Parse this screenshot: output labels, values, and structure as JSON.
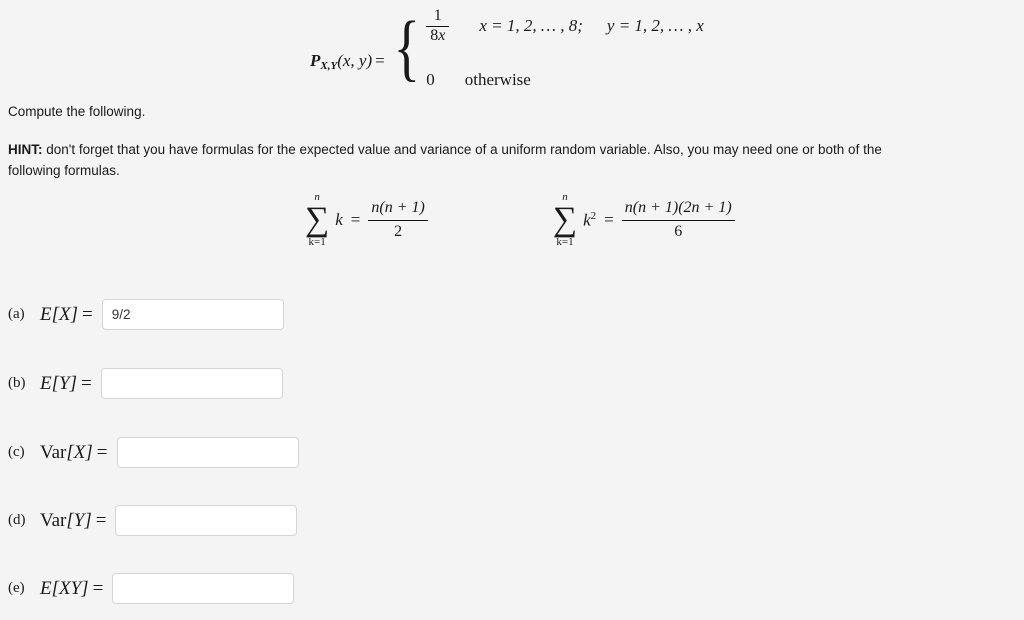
{
  "problem": {
    "pmf": {
      "lhs_p": "P",
      "lhs_sub": "X,Y",
      "lhs_args": "(x, y)",
      "equals": "=",
      "case1_numerator": "1",
      "case1_denominator_coeff": "8",
      "case1_denominator_var": "x",
      "case1_condition_x": "x = 1, 2, … , 8;",
      "case1_condition_y": "y = 1, 2, … , x",
      "case2_value": "0",
      "case2_condition": "otherwise"
    },
    "compute_instruction": "Compute the following.",
    "hint_bold": "HINT:",
    "hint_text": " don't forget that you have formulas for the expected value and variance of a uniform random variable. Also, you may need one or both of the following formulas.",
    "formulas": [
      {
        "upper_limit": "n",
        "lower_limit": "k=1",
        "sigma": "∑",
        "term": "k",
        "term_exponent": "",
        "equals": "=",
        "numerator": "n(n + 1)",
        "denominator": "2"
      },
      {
        "upper_limit": "n",
        "lower_limit": "k=1",
        "sigma": "∑",
        "term": "k",
        "term_exponent": "2",
        "equals": "=",
        "numerator": "n(n + 1)(2n + 1)",
        "denominator": "6"
      }
    ]
  },
  "answers": {
    "items": [
      {
        "tag": "(a)",
        "label": "E[X]",
        "label_upright": "",
        "equals": "=",
        "value": "9/2",
        "placeholder": ""
      },
      {
        "tag": "(b)",
        "label": "E[Y]",
        "label_upright": "",
        "equals": "=",
        "value": "",
        "placeholder": ""
      },
      {
        "tag": "(c)",
        "label": "[X]",
        "label_upright": "Var",
        "equals": "=",
        "value": "",
        "placeholder": ""
      },
      {
        "tag": "(d)",
        "label": "[Y]",
        "label_upright": "Var",
        "equals": "=",
        "value": "",
        "placeholder": ""
      },
      {
        "tag": "(e)",
        "label": "E[XY]",
        "label_upright": "",
        "equals": "=",
        "value": "",
        "placeholder": ""
      }
    ]
  },
  "theme": {
    "background": "#f4f4f4",
    "text": "#1a1a1a",
    "input_background": "#ffffff",
    "input_border": "#d5d5d5",
    "input_text": "#333333"
  }
}
